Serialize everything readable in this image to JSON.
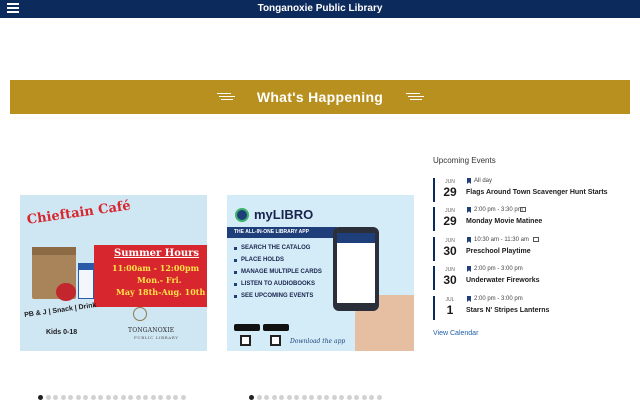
{
  "header": {
    "title": "Tonganoxie Public Library",
    "menu_icon": "hamburger-menu-icon",
    "background": "#0d2a5c"
  },
  "banner": {
    "title": "What's Happening",
    "background": "#b8901f"
  },
  "carousel_left": {
    "slide": {
      "title": "Chieftain Café",
      "hours_heading": "Summer Hours",
      "hours": "11:00am - 12:00pm",
      "days": "Mon.- Fri.",
      "dates": "May 18th-Aug. 10th",
      "offer": "PB & J | Snack | Drink",
      "audience": "Kids 0-18",
      "org_name": "TONGANOXIE",
      "org_sub": "PUBLIC LIBRARY"
    },
    "dot_count": 20,
    "active_dot": 0
  },
  "carousel_right": {
    "slide": {
      "title": "myLIBRO",
      "tagline": "THE ALL-IN-ONE LIBRARY APP",
      "features": [
        "SEARCH THE CATALOG",
        "PLACE HOLDS",
        "MANAGE MULTIPLE CARDS",
        "LISTEN TO AUDIOBOOKS",
        "SEE UPCOMING EVENTS"
      ],
      "download_text": "Download the app"
    },
    "dot_count": 18,
    "active_dot": 0
  },
  "events": {
    "heading": "Upcoming Events",
    "items": [
      {
        "month": "JUN",
        "day": "29",
        "time": "All day",
        "title": "Flags Around Town Scavenger Hunt Starts",
        "repeat": false
      },
      {
        "month": "JUN",
        "day": "29",
        "time": "2:00 pm - 3:30 pm",
        "title": "Monday Movie Matinee",
        "repeat": true
      },
      {
        "month": "JUN",
        "day": "30",
        "time": "10:30 am - 11:30 am",
        "title": "Preschool Playtime",
        "repeat": true
      },
      {
        "month": "JUN",
        "day": "30",
        "time": "2:00 pm - 3:00 pm",
        "title": "Underwater Fireworks",
        "repeat": false
      },
      {
        "month": "JUL",
        "day": "1",
        "time": "2:00 pm - 3:00 pm",
        "title": "Stars N' Stripes Lanterns",
        "repeat": false
      }
    ],
    "view_calendar_label": "View Calendar"
  }
}
